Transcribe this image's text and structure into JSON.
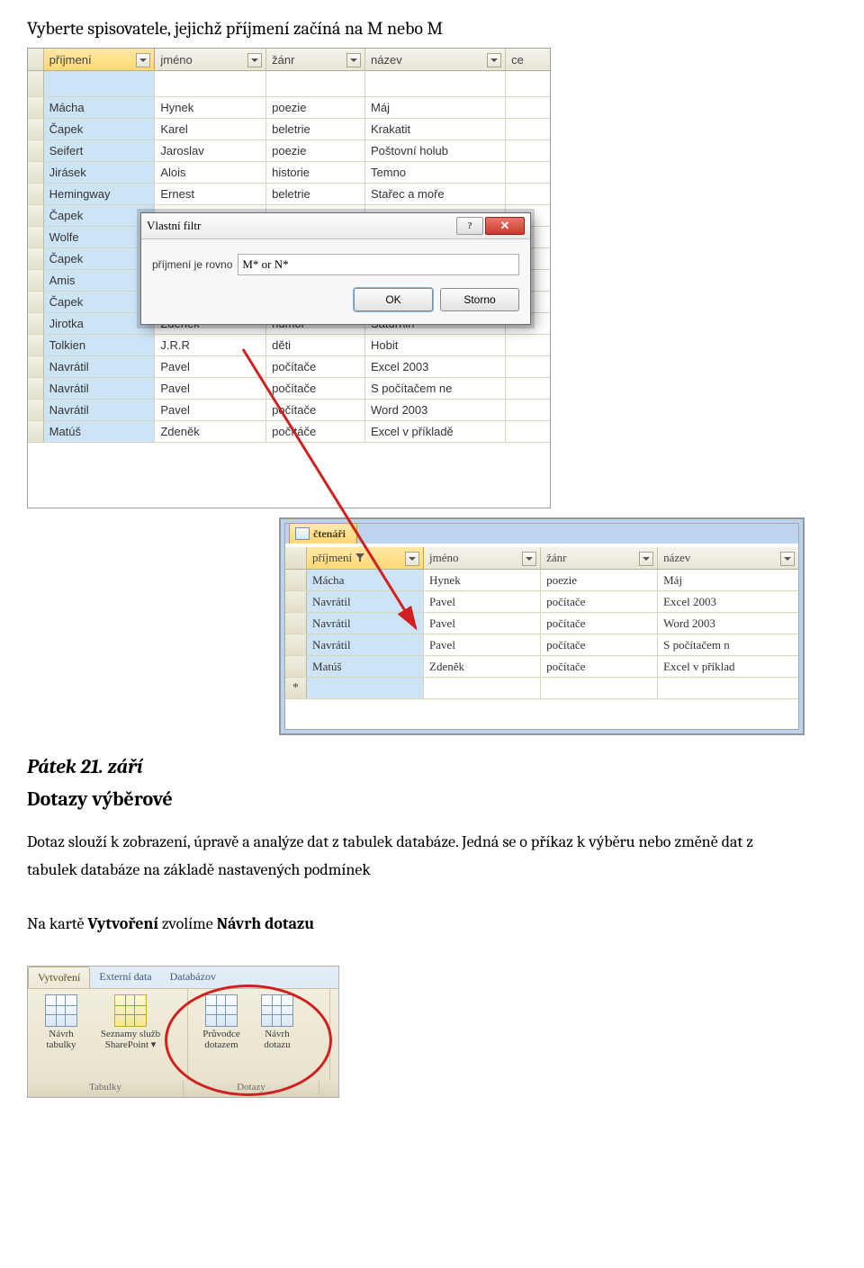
{
  "heading": "Vyberte spisovatele, jejichž příjmení začíná na M nebo M",
  "table1": {
    "headers": [
      "příjmení",
      "jméno",
      "žánr",
      "název",
      "ce"
    ],
    "rows": [
      [
        "Mácha",
        "Hynek",
        "poezie",
        "Máj",
        ""
      ],
      [
        "Čapek",
        "Karel",
        "beletrie",
        "Krakatit",
        ""
      ],
      [
        "Seifert",
        "Jaroslav",
        "poezie",
        "Poštovní holub",
        ""
      ],
      [
        "Jirásek",
        "Alois",
        "historie",
        "Temno",
        ""
      ],
      [
        "Hemingway",
        "Ernest",
        "beletrie",
        "Stařec a moře",
        ""
      ],
      [
        "Čapek",
        "",
        "",
        "",
        ""
      ],
      [
        "Wolfe",
        "",
        "",
        "",
        ""
      ],
      [
        "Čapek",
        "",
        "",
        "",
        ""
      ],
      [
        "Amis",
        "",
        "",
        "",
        ""
      ],
      [
        "Čapek",
        "",
        "",
        "",
        ""
      ],
      [
        "Jirotka",
        "Zdeněk",
        "humor",
        "Saturnin",
        ""
      ],
      [
        "Tolkien",
        "J.R.R",
        "děti",
        "Hobit",
        ""
      ],
      [
        "Navrátil",
        "Pavel",
        "počítače",
        "Excel 2003",
        ""
      ],
      [
        "Navrátil",
        "Pavel",
        "počítače",
        "S počítačem ne",
        ""
      ],
      [
        "Navrátil",
        "Pavel",
        "počítače",
        "Word 2003",
        ""
      ],
      [
        "Matúš",
        "Zdeněk",
        "počítáče",
        "Excel v příkladě",
        ""
      ]
    ]
  },
  "dialog": {
    "title": "Vlastní filtr",
    "label": "příjmení je rovno",
    "value": "M* or N*",
    "ok": "OK",
    "cancel": "Storno"
  },
  "table2": {
    "tab": "čtenáři",
    "headers": [
      "příjmení",
      "jméno",
      "žánr",
      "název"
    ],
    "rows": [
      [
        "Mácha",
        "Hynek",
        "poezie",
        "Máj"
      ],
      [
        "Navrátil",
        "Pavel",
        "počítače",
        "Excel 2003"
      ],
      [
        "Navrátil",
        "Pavel",
        "počítače",
        "Word 2003"
      ],
      [
        "Navrátil",
        "Pavel",
        "počítače",
        "S počítačem n"
      ],
      [
        "Matúš",
        "Zdeněk",
        "počítače",
        "Excel v příklad"
      ]
    ]
  },
  "section2": {
    "date": "Pátek 21. září",
    "title": "Dotazy výběrové",
    "para1": "Dotaz slouží k zobrazení, úpravě a analýze dat z tabulek databáze. Jedná se o příkaz k výběru nebo změně dat z tabulek databáze na základě nastavených podmínek",
    "para2a": "Na kartě ",
    "para2b": "Vytvoření",
    "para2c": " zvolíme ",
    "para2d": "Návrh dotazu"
  },
  "ribbon": {
    "tabs": [
      "Vytvoření",
      "Externí data",
      "Databázov"
    ],
    "buttons": [
      {
        "l1": "Návrh",
        "l2": "tabulky"
      },
      {
        "l1": "Seznamy služb",
        "l2": "SharePoint ▾"
      },
      {
        "l1": "Průvodce",
        "l2": "dotazem"
      },
      {
        "l1": "Návrh",
        "l2": "dotazu"
      }
    ],
    "groups": [
      "Tabulky",
      "Dotazy"
    ]
  }
}
